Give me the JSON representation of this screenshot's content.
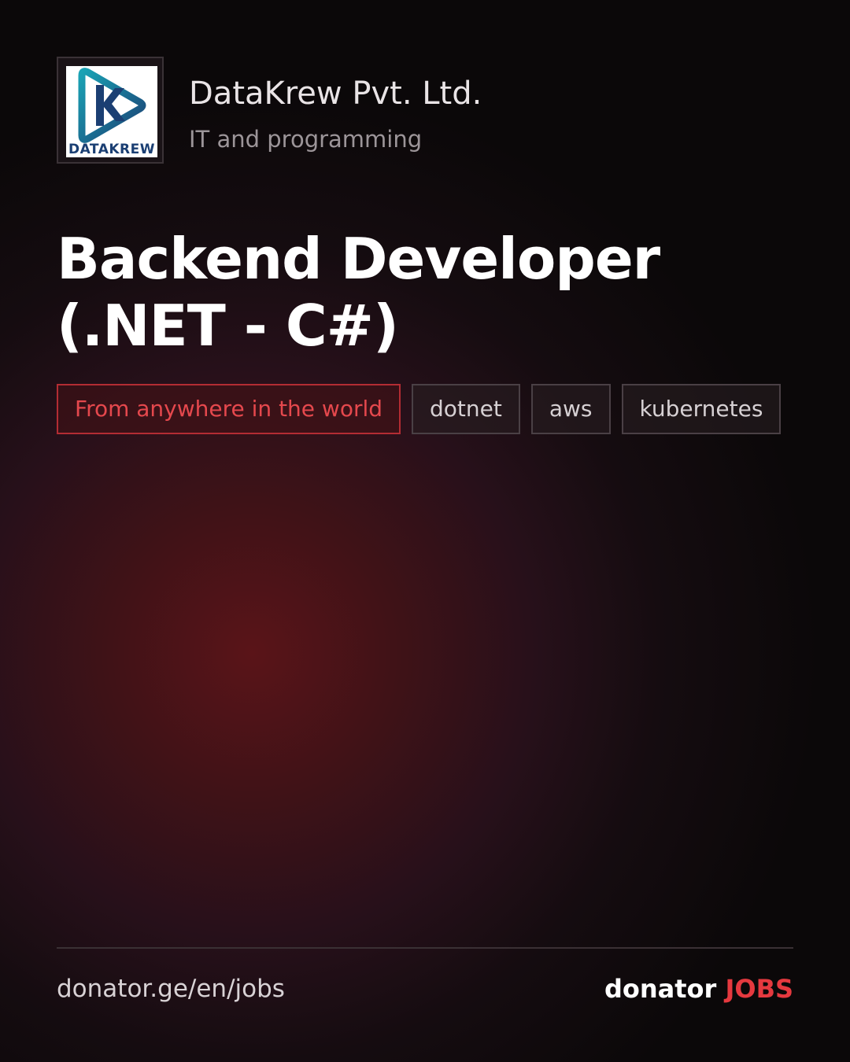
{
  "company": {
    "logo_text": "DATAKREW",
    "name": "DataKrew Pvt. Ltd.",
    "category": "IT and programming"
  },
  "job": {
    "title": "Backend Developer (.NET - C#)"
  },
  "tags": {
    "location": "From anywhere in the world",
    "skills": [
      "dotnet",
      "aws",
      "kubernetes"
    ]
  },
  "footer": {
    "url": "donator.ge/en/jobs",
    "brand_main": "donator",
    "brand_accent": "JOBS"
  },
  "colors": {
    "accent": "#e5393f",
    "background": "#0b0809",
    "glow": "#5a1418",
    "logo_blue": "#1b3f73",
    "logo_teal": "#1aa3b5"
  },
  "icons": {
    "company_logo": "datakrew-logo"
  }
}
